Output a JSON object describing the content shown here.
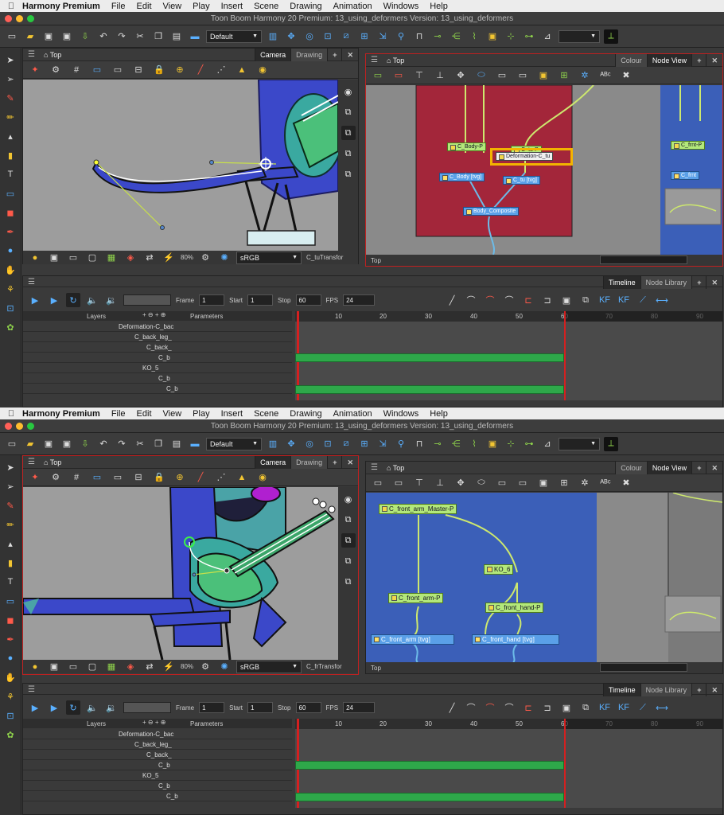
{
  "menubar": {
    "app_name": "Harmony Premium",
    "items": [
      "File",
      "Edit",
      "View",
      "Play",
      "Insert",
      "Scene",
      "Drawing",
      "Animation",
      "Windows",
      "Help"
    ]
  },
  "window_title": "Toon Boom Harmony 20 Premium: 13_using_deformers Version: 13_using_deformers",
  "toolbar": {
    "workspace": "Default"
  },
  "colors": {
    "accent_red": "#c02020",
    "node_green": "#b3e87a",
    "node_blue_bg": "#3b5fb8",
    "node_red_bg": "#a3263a",
    "highlight": "#f2b400",
    "exposure_green": "#2ea84a"
  },
  "shots": [
    {
      "camera_panel": {
        "title": "Top",
        "tabs": [
          "Camera",
          "Drawing"
        ],
        "zoom": "80%",
        "colorspace": "sRGB",
        "selected_node": "C_tuTransfor"
      },
      "node_panel": {
        "title": "Top",
        "tabs": [
          "Colour",
          "Node View"
        ],
        "footer": "Top",
        "nodes": [
          "C_Body-P",
          "C_tu-P",
          "C_Body [tvg]",
          "C_tu [tvg]",
          "Body_Composite",
          "Deformation-C_tu",
          "C_frnt-P",
          "C_frnt"
        ]
      },
      "timeline": {
        "tabs": [
          "Timeline",
          "Node Library"
        ],
        "frame_label": "Frame",
        "frame": "1",
        "start_label": "Start",
        "start": "1",
        "stop_label": "Stop",
        "stop": "60",
        "fps_label": "FPS",
        "fps": "24",
        "layers_header": "Layers",
        "params_header": "Parameters",
        "layers": [
          "Deformation-C_bac",
          "C_back_leg_",
          "C_back_",
          "C_b",
          "KO_5",
          "C_b",
          "C_b"
        ],
        "ruler": [
          "10",
          "20",
          "30",
          "40",
          "50",
          "60",
          "70",
          "80",
          "90"
        ]
      }
    },
    {
      "camera_panel": {
        "title": "Top",
        "tabs": [
          "Camera",
          "Drawing"
        ],
        "zoom": "80%",
        "colorspace": "sRGB",
        "selected_node": "C_frTransfor"
      },
      "node_panel": {
        "title": "Top",
        "tabs": [
          "Colour",
          "Node View"
        ],
        "footer": "Top",
        "nodes": [
          "C_front_arm_Master-P",
          "KO_6",
          "C_front_arm-P",
          "C_front_hand-P",
          "C_front_arm [tvg]",
          "C_front_hand [tvg]"
        ]
      },
      "timeline": {
        "tabs": [
          "Timeline",
          "Node Library"
        ],
        "frame_label": "Frame",
        "frame": "1",
        "start_label": "Start",
        "start": "1",
        "stop_label": "Stop",
        "stop": "60",
        "fps_label": "FPS",
        "fps": "24",
        "layers_header": "Layers",
        "params_header": "Parameters",
        "layers": [
          "Deformation-C_bac",
          "C_back_leg_",
          "C_back_",
          "C_b",
          "KO_5",
          "C_b",
          "C_b"
        ],
        "ruler": [
          "10",
          "20",
          "30",
          "40",
          "50",
          "60",
          "70",
          "80",
          "90"
        ]
      }
    }
  ]
}
